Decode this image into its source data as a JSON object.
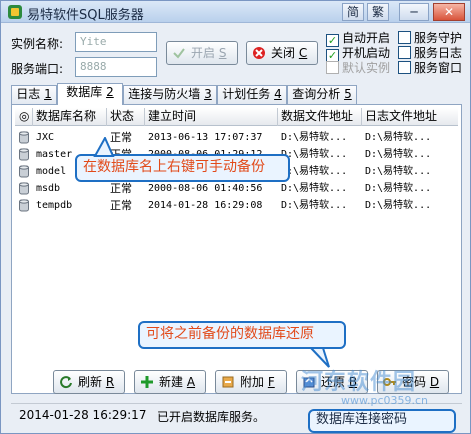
{
  "window": {
    "title": "易特软件SQL服务器",
    "lang_simplified": "简",
    "lang_traditional": "繁",
    "minimize": "─",
    "close": "✕"
  },
  "instance": {
    "name_label": "实例名称:",
    "name_value": "Yite",
    "port_label": "服务端口:",
    "port_value": "8888"
  },
  "buttons": {
    "start": "开启",
    "start_key": "S",
    "stop": "关闭",
    "stop_key": "C"
  },
  "options": [
    {
      "label": "自动开启",
      "checked": true,
      "enabled": true
    },
    {
      "label": "服务守护",
      "checked": false,
      "enabled": true
    },
    {
      "label": "开机启动",
      "checked": true,
      "enabled": true
    },
    {
      "label": "服务日志",
      "checked": false,
      "enabled": true
    },
    {
      "label": "默认实例",
      "checked": false,
      "enabled": false
    },
    {
      "label": "服务窗口",
      "checked": false,
      "enabled": true
    }
  ],
  "tabs": [
    {
      "label": "日志",
      "key": "1"
    },
    {
      "label": "数据库",
      "key": "2"
    },
    {
      "label": "连接与防火墙",
      "key": "3"
    },
    {
      "label": "计划任务",
      "key": "4"
    },
    {
      "label": "查询分析",
      "key": "5"
    }
  ],
  "table": {
    "headers": [
      "◎",
      "数据库名称",
      "状态",
      "建立时间",
      "数据文件地址",
      "日志文件地址"
    ],
    "rows": [
      {
        "name": "JXC",
        "status": "正常",
        "created": "2013-06-13 17:07:37",
        "data_path": "D:\\易特软...",
        "log_path": "D:\\易特软..."
      },
      {
        "name": "master",
        "status": "正常",
        "created": "2000-08-06 01:29:12",
        "data_path": "D:\\易特软...",
        "log_path": "D:\\易特软..."
      },
      {
        "name": "model",
        "status": "正常",
        "created": "2000-08-06 01:40:52",
        "data_path": "D:\\易特软...",
        "log_path": "D:\\易特软..."
      },
      {
        "name": "msdb",
        "status": "正常",
        "created": "2000-08-06 01:40:56",
        "data_path": "D:\\易特软...",
        "log_path": "D:\\易特软..."
      },
      {
        "name": "tempdb",
        "status": "正常",
        "created": "2014-01-28 16:29:08",
        "data_path": "D:\\易特软...",
        "log_path": "D:\\易特软..."
      }
    ]
  },
  "callouts": {
    "top": "在数据库名上右键可手动备份",
    "mid": "可将之前备份的数据库还原",
    "bottom": "数据库连接密码"
  },
  "bottom_buttons": [
    {
      "label": "刷新",
      "key": "R"
    },
    {
      "label": "新建",
      "key": "A"
    },
    {
      "label": "附加",
      "key": "F"
    },
    {
      "label": "还原",
      "key": "B"
    },
    {
      "label": "密码",
      "key": "D"
    }
  ],
  "status": {
    "time": "2014-01-28 16:29:17",
    "message": "已开启数据库服务。"
  },
  "watermark": {
    "site_name": "河东软件园",
    "url": "www.pc0359.cn"
  },
  "colors": {
    "accent": "#1e6fc4",
    "callout_text": "#e24a1a"
  }
}
